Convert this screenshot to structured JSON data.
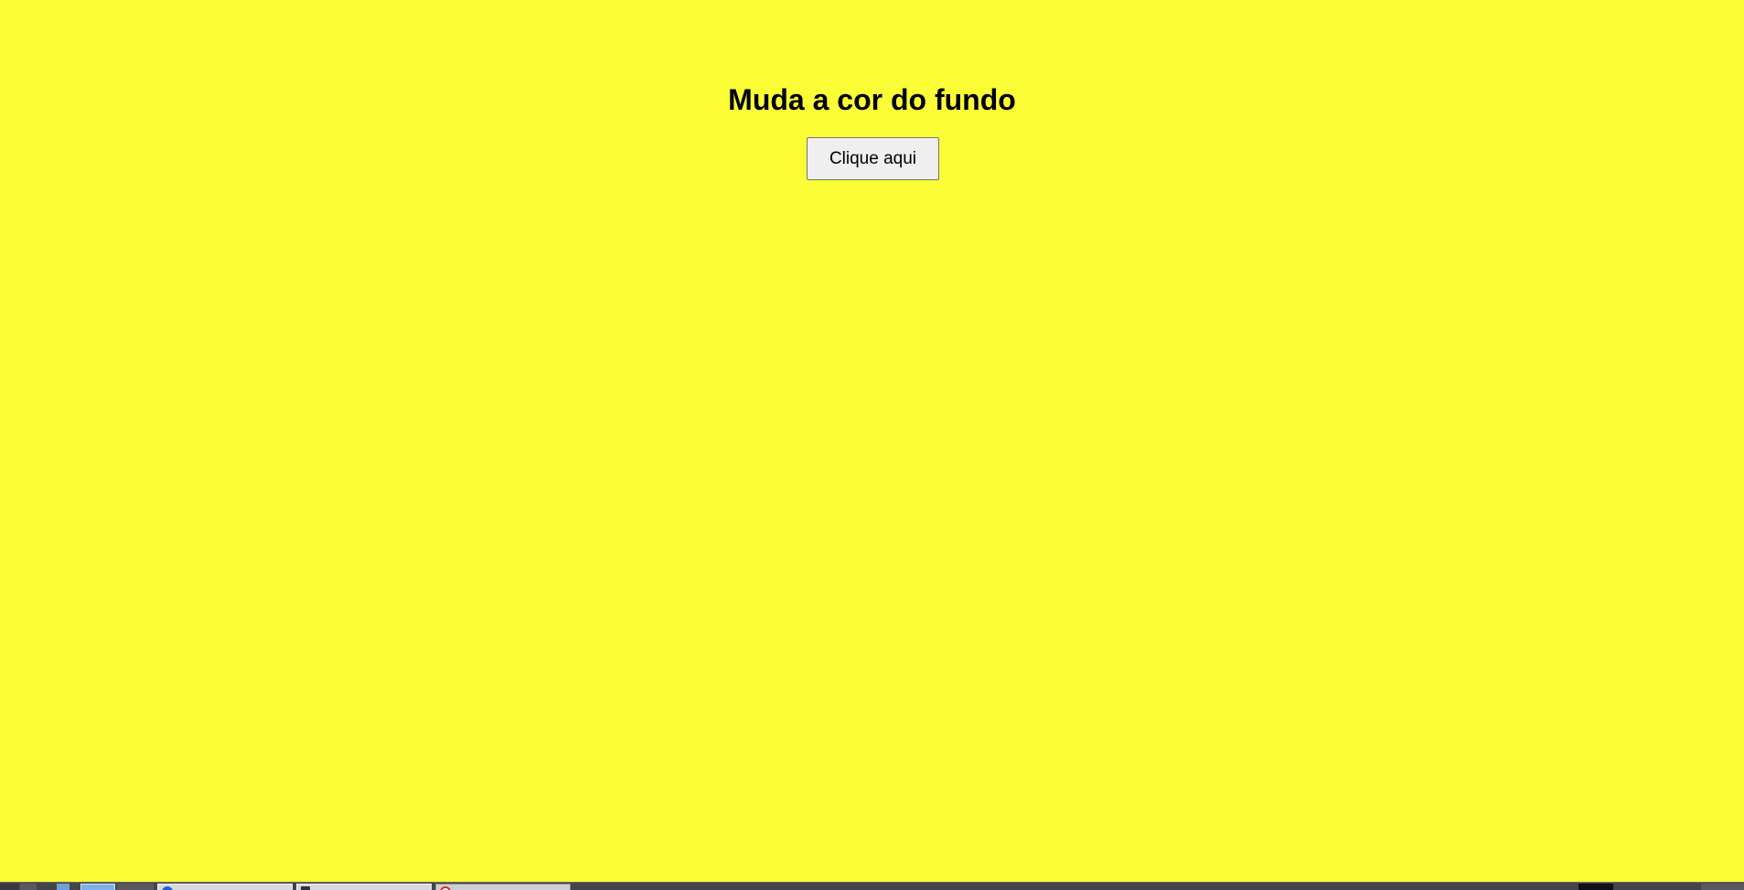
{
  "page": {
    "title": "Muda a cor do fundo",
    "button_label": "Clique aqui",
    "background_color": "#fbfe36"
  },
  "taskbar": {
    "tasks": [
      {
        "icon": "browser-icon"
      },
      {
        "icon": "terminal-icon"
      },
      {
        "icon": "app-icon"
      }
    ]
  }
}
